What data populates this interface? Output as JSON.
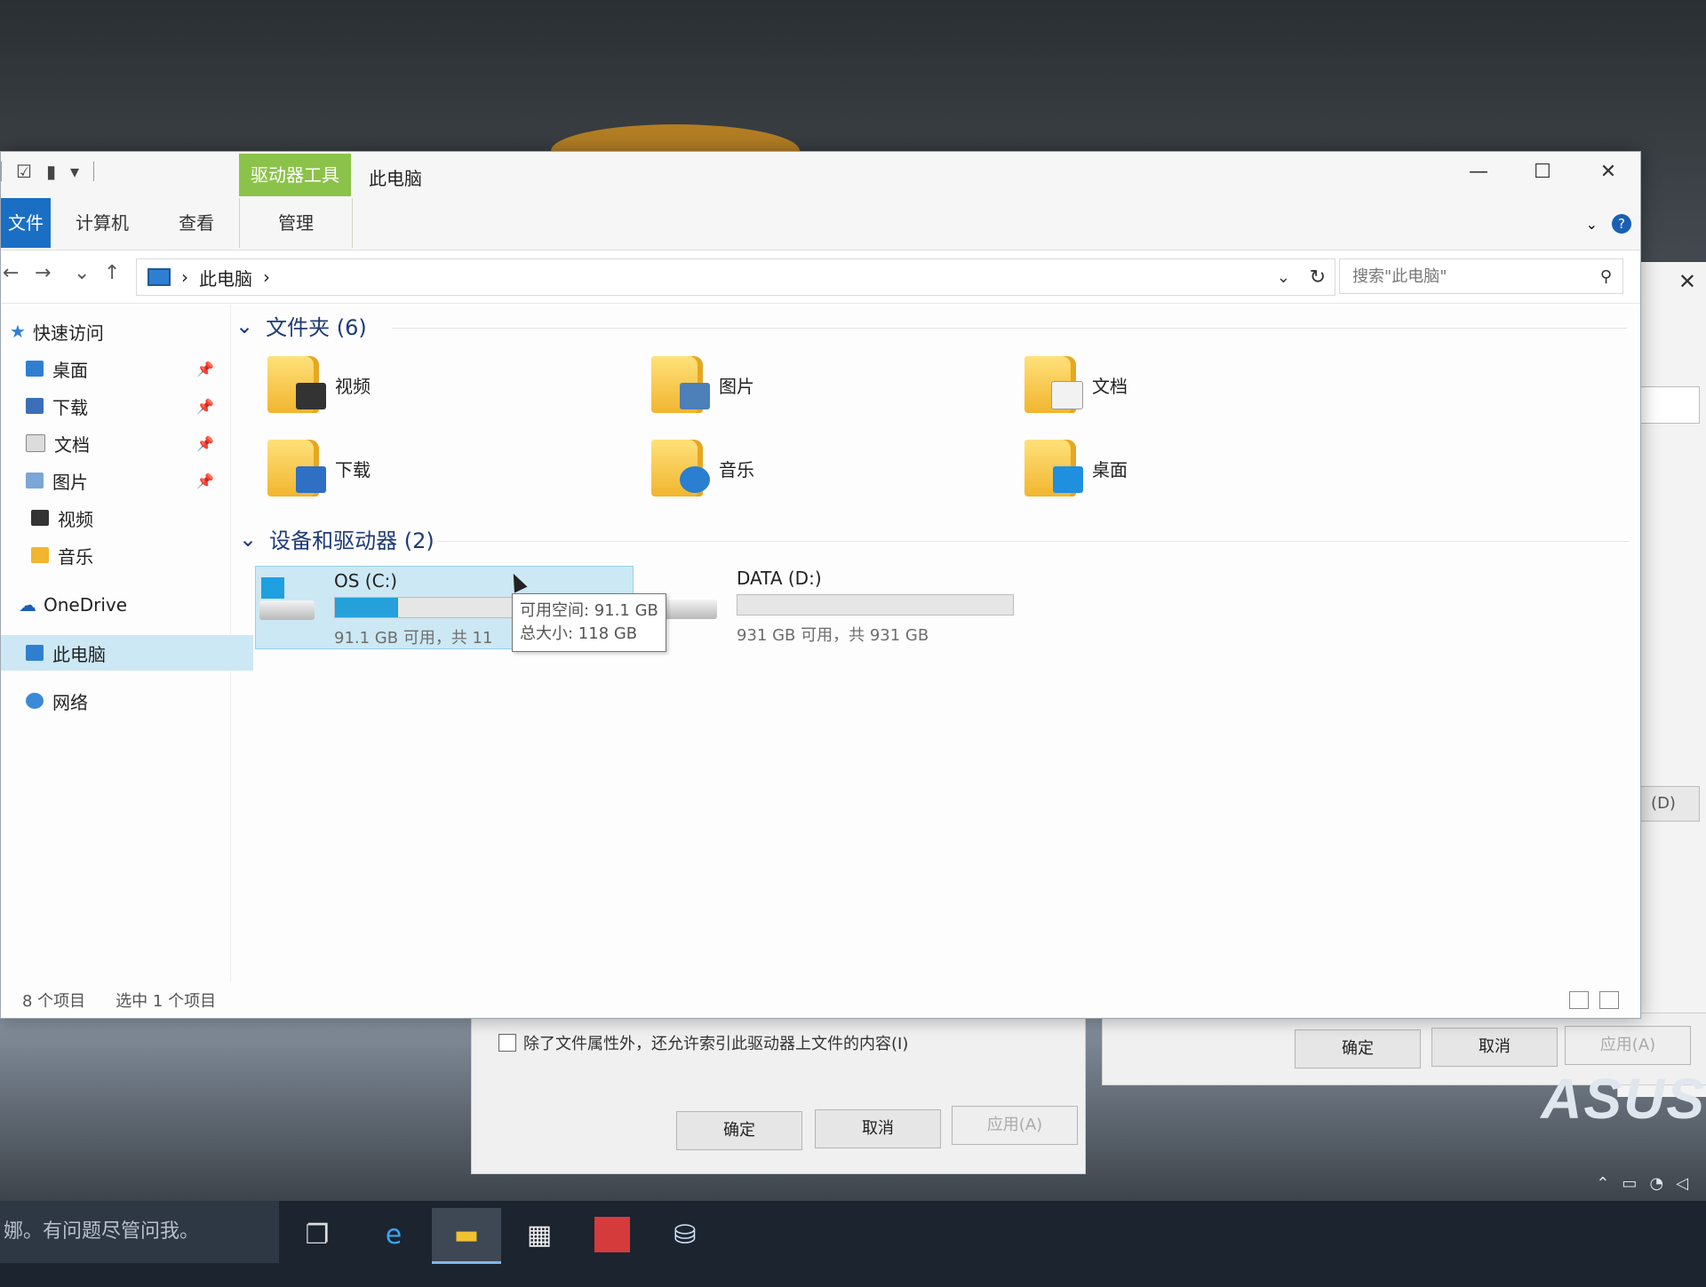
{
  "window": {
    "context_tab": "驱动器工具",
    "title": "此电脑",
    "tabs": [
      "文件",
      "计算机",
      "查看",
      "管理"
    ]
  },
  "address": {
    "location": "此电脑",
    "separator": "›"
  },
  "search": {
    "placeholder": "搜索\"此电脑\""
  },
  "sidebar": {
    "quick_access": "快速访问",
    "pinned": [
      "桌面",
      "下载",
      "文档",
      "图片"
    ],
    "recent": [
      "视频",
      "音乐"
    ],
    "onedrive": "OneDrive",
    "this_pc": "此电脑",
    "network": "网络"
  },
  "folders_group": {
    "title": "文件夹 (6)",
    "items": [
      "视频",
      "图片",
      "文档",
      "下载",
      "音乐",
      "桌面"
    ]
  },
  "drives_group": {
    "title": "设备和驱动器 (2)",
    "drives": [
      {
        "name": "OS (C:)",
        "space_text": "91.1 GB 可用，共 11",
        "used_fraction": 0.23
      },
      {
        "name": "DATA (D:)",
        "space_text": "931 GB 可用，共 931 GB",
        "used_fraction": 0.0
      }
    ]
  },
  "tooltip": {
    "line1": "可用空间: 91.1 GB",
    "line2": "总大小: 118 GB"
  },
  "status": {
    "count": "8 个项目",
    "selected": "选中 1 个项目"
  },
  "background_dialog_a": {
    "checkbox_label": "除了文件属性外，还允许索引此驱动器上文件的内容(I)",
    "ok": "确定",
    "cancel": "取消",
    "apply": "应用(A)"
  },
  "background_dialog_b": {
    "ok": "确定",
    "cancel": "取消",
    "apply": "应用(A)"
  },
  "background_side": {
    "button_fragment": "(D)"
  },
  "taskbar": {
    "search_text": "娜。有问题尽管问我。"
  },
  "brand": {
    "watermark": "ASUS"
  },
  "colors": {
    "accent": "#1a6fc4",
    "context_green": "#8bc34a",
    "selection": "#cce8f4",
    "bar_fill": "#26a0da"
  }
}
